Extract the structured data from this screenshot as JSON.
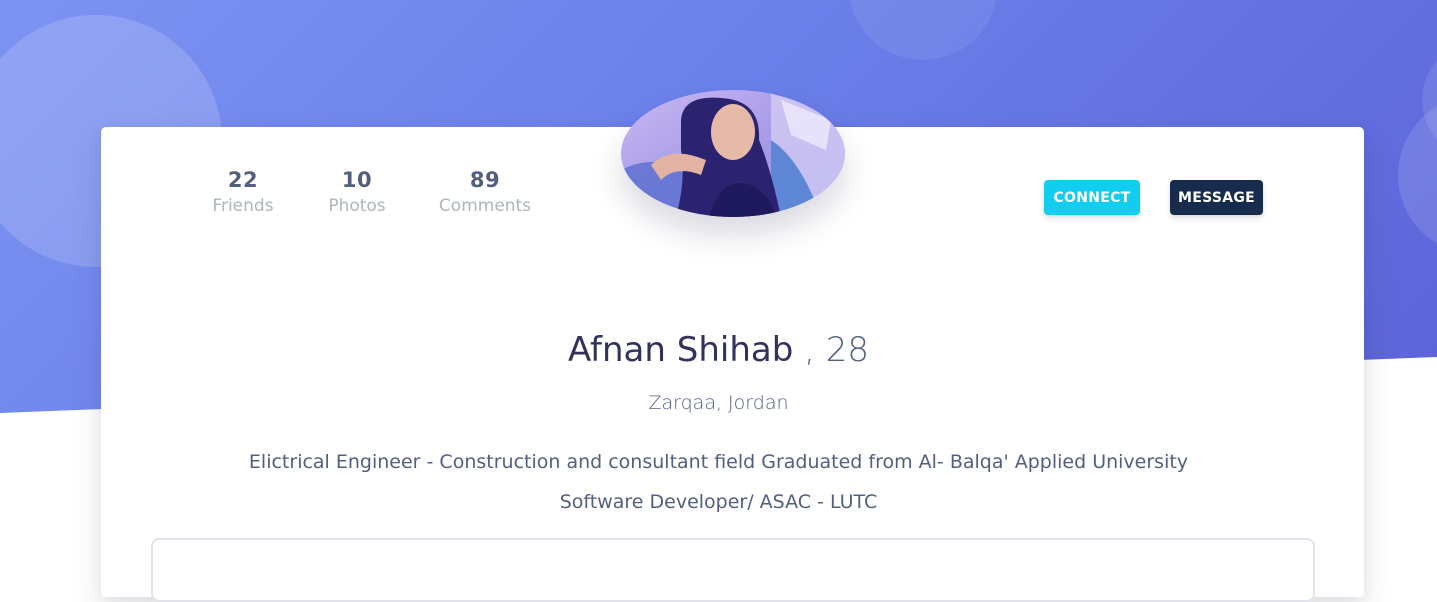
{
  "stats": [
    {
      "value": "22",
      "label": "Friends"
    },
    {
      "value": "10",
      "label": "Photos"
    },
    {
      "value": "89",
      "label": "Comments"
    }
  ],
  "actions": {
    "connect_label": "CONNECT",
    "message_label": "MESSAGE"
  },
  "profile": {
    "name": "Afnan Shihab",
    "age_suffix": ", 28",
    "location": "Zarqaa, Jordan",
    "bio_line1": "Elictrical Engineer - Construction and consultant field Graduated from Al- Balqa' Applied University",
    "bio_line2": "Software Developer/ ASAC - LUTC"
  },
  "colors": {
    "hero_gradient_start": "#7c93f2",
    "hero_gradient_end": "#5d63d8",
    "connect_button": "#11cdef",
    "message_button": "#172b4d"
  },
  "avatar_icon": "profile-photo"
}
